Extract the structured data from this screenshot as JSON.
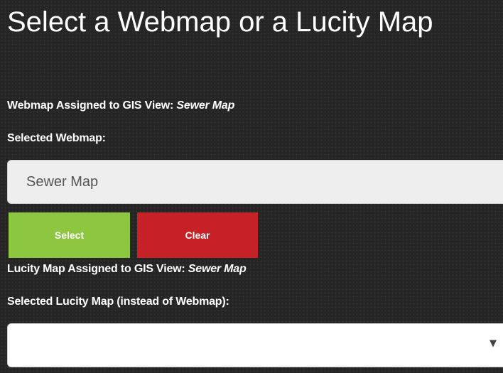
{
  "title": "Select a Webmap or a Lucity Map",
  "webmap": {
    "assigned_label": "Webmap Assigned to GIS View:",
    "assigned_value": "Sewer Map",
    "selected_label": "Selected Webmap:",
    "selected_value": "Sewer Map"
  },
  "buttons": {
    "select_label": "Select",
    "clear_label": "Clear"
  },
  "lucity": {
    "assigned_label": "Lucity Map Assigned to GIS View:",
    "assigned_value": "Sewer Map",
    "selected_label": "Selected Lucity Map (instead of Webmap):",
    "selected_value": ""
  },
  "icons": {
    "dropdown": "chevron-down-icon"
  },
  "colors": {
    "background": "#252525",
    "select_button": "#8dc63f",
    "clear_button": "#c52127"
  }
}
